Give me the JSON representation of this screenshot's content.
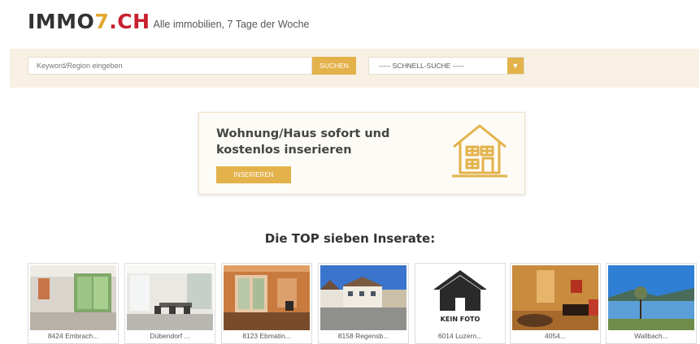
{
  "header": {
    "logo_part1": "IMMO",
    "logo_part2": "7",
    "logo_part3": ".CH",
    "tagline": "Alle immobilien, 7 Tage der Woche"
  },
  "search": {
    "placeholder": "Keyword/Region eingeben",
    "button_label": "SUCHEN",
    "quick_search_label": "----- SCHNELL-SUCHE -----",
    "dropdown_arrow": "▼"
  },
  "promo": {
    "title": "Wohnung/Haus sofort und kostenlos inserieren",
    "button_label": "INSERIEREN",
    "icon": "house-icon"
  },
  "top": {
    "heading": "Die TOP sieben Inserate:"
  },
  "listings": [
    {
      "caption": "8424 Embrach...",
      "image": "interior-photo"
    },
    {
      "caption": "Dübendorf ...",
      "image": "office-photo"
    },
    {
      "caption": "8123 Ebmatin...",
      "image": "room-photo"
    },
    {
      "caption": "8158 Regensb...",
      "image": "street-photo"
    },
    {
      "caption": "6014 Luzern...",
      "image": "no-photo",
      "placeholder_text": "KEIN FOTO"
    },
    {
      "caption": "4054...",
      "image": "living-room-photo"
    },
    {
      "caption": "Wallbach...",
      "image": "lake-photo"
    }
  ],
  "colors": {
    "accent": "#e3b24a",
    "logo_red": "#c8202f",
    "search_bg": "#f7f0e3"
  }
}
